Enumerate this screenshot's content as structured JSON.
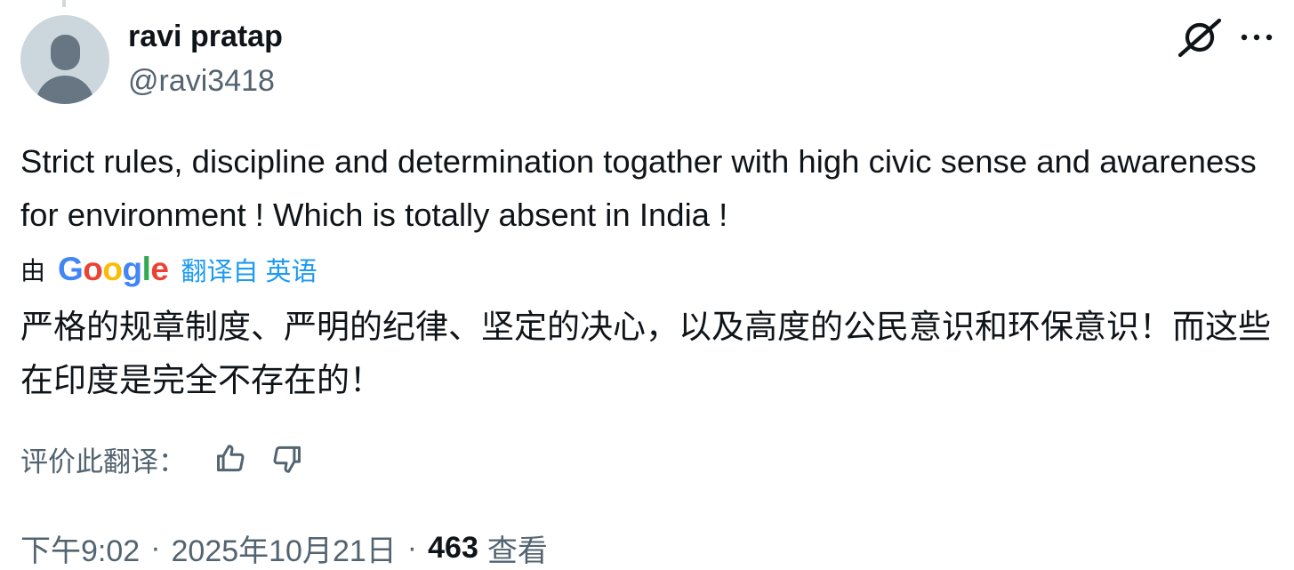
{
  "author": {
    "display_name": "ravi pratap",
    "handle": "@ravi3418"
  },
  "tweet": {
    "text": "Strict rules, discipline and determination togather with high civic sense and awareness for environment ! Which is totally absent in India !",
    "translated_text": "严格的规章制度、严明的纪律、坚定的决心，以及高度的公民意识和环保意识！而这些在印度是完全不存在的！"
  },
  "translation": {
    "by_label": "由",
    "provider_logo_letters": [
      "G",
      "o",
      "o",
      "g",
      "l",
      "e"
    ],
    "link_label": "翻译自 英语",
    "rate_label": "评价此翻译："
  },
  "meta": {
    "time": "下午9:02",
    "date": "2025年10月21日",
    "separator": "·",
    "views_count": "463",
    "views_label": "查看"
  },
  "icons": {
    "grok": "grok-icon",
    "more": "more-horizontal-icon",
    "thumb_up": "thumb-up-icon",
    "thumb_down": "thumb-down-icon"
  },
  "colors": {
    "text_primary": "#0f1419",
    "text_secondary": "#536471",
    "link": "#1d9bf0",
    "avatar_bg": "#ccd6dd",
    "avatar_fg": "#687684"
  }
}
